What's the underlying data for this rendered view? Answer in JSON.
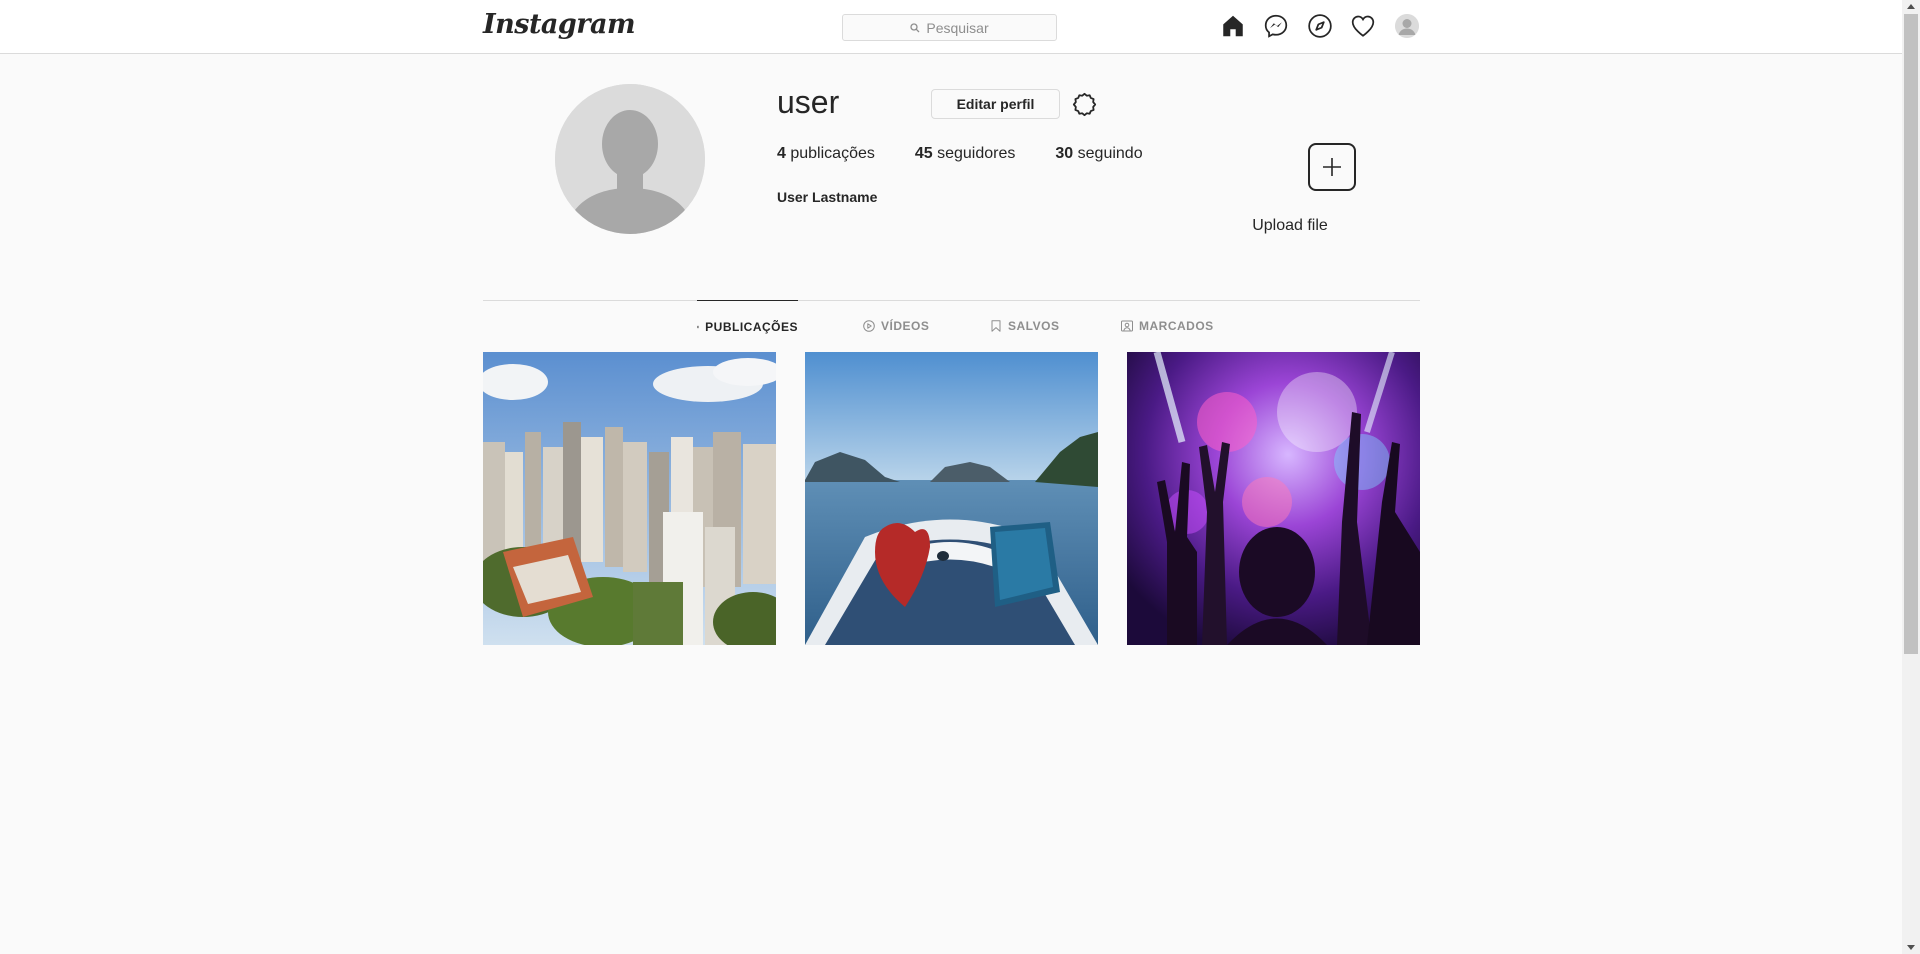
{
  "header": {
    "logo": "Instagram",
    "search_placeholder": "Pesquisar",
    "nav_icons": [
      "home-icon",
      "messenger-icon",
      "explore-icon",
      "heart-icon",
      "avatar"
    ]
  },
  "profile": {
    "username": "user",
    "edit_button": "Editar perfil",
    "stats": [
      {
        "count": "4",
        "label": "publicações"
      },
      {
        "count": "45",
        "label": "seguidores"
      },
      {
        "count": "30",
        "label": "seguindo"
      }
    ],
    "full_name": "User Lastname",
    "upload_label": "Upload file"
  },
  "tabs": [
    {
      "label": "PUBLICAÇÕES",
      "icon": "grid-icon",
      "active": true
    },
    {
      "label": "VÍDEOS",
      "icon": "play-icon",
      "active": false
    },
    {
      "label": "SALVOS",
      "icon": "bookmark-icon",
      "active": false
    },
    {
      "label": "MARCADOS",
      "icon": "tag-user-icon",
      "active": false
    }
  ],
  "posts": [
    {
      "subject": "city-aerial-photo"
    },
    {
      "subject": "boat-lake-photo"
    },
    {
      "subject": "concert-crowd-photo"
    }
  ],
  "colors": {
    "background": "#fafafa",
    "border": "#dbdbdb",
    "text": "#262626",
    "muted": "#8e8e8e"
  }
}
